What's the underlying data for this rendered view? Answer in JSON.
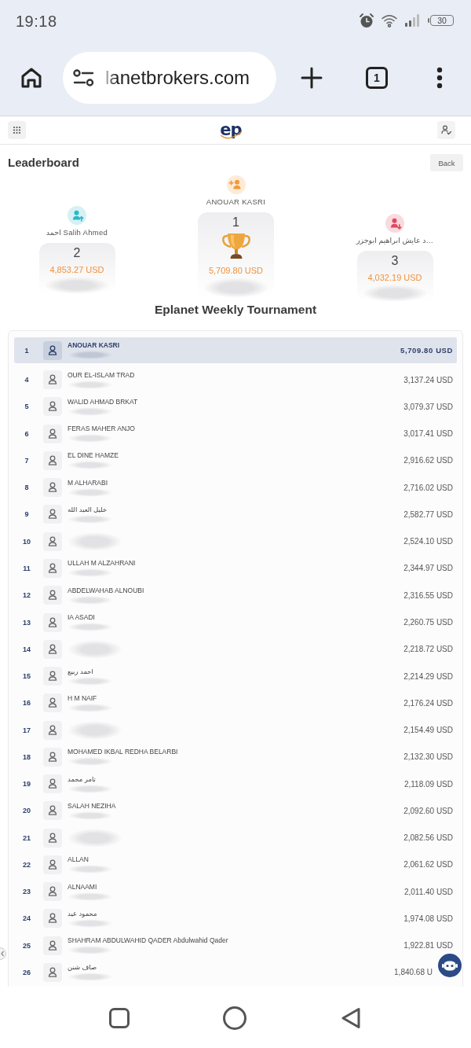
{
  "status_bar": {
    "time": "19:18",
    "battery": "30"
  },
  "browser": {
    "url": "lanetbrokers.com",
    "tab_count": "1"
  },
  "app_header": {
    "logo": "ep"
  },
  "page": {
    "title": "Leaderboard",
    "back_button": "Back"
  },
  "podium": [
    {
      "kind": "second",
      "name": "احمد Salih Ahmed",
      "rank": "2",
      "amount": "4,853.27 USD",
      "color": "#2bb8c8"
    },
    {
      "kind": "winner",
      "name": "ANOUAR KASRI",
      "rank": "1",
      "amount": "5,709.80 USD",
      "color": "#f39a3d"
    },
    {
      "kind": "third",
      "name": "د عايش ابراهيم ابوجزر…",
      "rank": "3",
      "amount": "4,032.19 USD",
      "color": "#e2475f"
    }
  ],
  "tournament": {
    "title": "Eplanet Weekly Tournament"
  },
  "leaderboard": {
    "rows": [
      {
        "rank": "1",
        "name": "ANOUAR KASRI",
        "amount": "5,709.80 USD",
        "selected": true
      },
      {
        "rank": "4",
        "name": "OUR EL-ISLAM TRAD",
        "amount": "3,137.24 USD",
        "selected": false
      },
      {
        "rank": "5",
        "name": "WALID AHMAD BRKAT",
        "amount": "3,079.37 USD",
        "selected": false
      },
      {
        "rank": "6",
        "name": "FERAS MAHER ANJO",
        "amount": "3,017.41 USD",
        "selected": false
      },
      {
        "rank": "7",
        "name": "EL DINE HAMZE",
        "amount": "2,916.62 USD",
        "selected": false
      },
      {
        "rank": "8",
        "name": "M ALHARABI",
        "amount": "2,716.02 USD",
        "selected": false
      },
      {
        "rank": "9",
        "name": "خليل العبد الله",
        "amount": "2,582.77 USD",
        "selected": false
      },
      {
        "rank": "10",
        "amount": "2,524.10 USD",
        "selected": false
      },
      {
        "rank": "11",
        "name": "ULLAH M ALZAHRANI",
        "amount": "2,344.97 USD",
        "selected": false
      },
      {
        "rank": "12",
        "name": "ABDELWAHAB ALNOUBI",
        "amount": "2,316.55 USD",
        "selected": false
      },
      {
        "rank": "13",
        "name": "IA ASADI",
        "amount": "2,260.75 USD",
        "selected": false
      },
      {
        "rank": "14",
        "amount": "2,218.72 USD",
        "selected": false
      },
      {
        "rank": "15",
        "name": "احمد ربيع",
        "amount": "2,214.29 USD",
        "selected": false
      },
      {
        "rank": "16",
        "name": "H M NAIF",
        "amount": "2,176.24 USD",
        "selected": false
      },
      {
        "rank": "17",
        "amount": "2,154.49 USD",
        "selected": false
      },
      {
        "rank": "18",
        "name": "MOHAMED IKBAL REDHA BELARBI",
        "amount": "2,132.30 USD",
        "selected": false
      },
      {
        "rank": "19",
        "name": "تامر محمد",
        "amount": "2,118.09 USD",
        "selected": false
      },
      {
        "rank": "20",
        "name": "SALAH NEZIHA",
        "amount": "2,092.60 USD",
        "selected": false
      },
      {
        "rank": "21",
        "amount": "2,082.56 USD",
        "selected": false
      },
      {
        "rank": "22",
        "name": "ALLAN",
        "amount": "2,061.62 USD",
        "selected": false
      },
      {
        "rank": "23",
        "name": "ALNAAMI",
        "amount": "2,011.40 USD",
        "selected": false
      },
      {
        "rank": "24",
        "name": "محمود عيد",
        "amount": "1,974.08 USD",
        "selected": false
      },
      {
        "rank": "25",
        "name": "SHAHRAM ABDULWAHID QADER Abdulwahid Qader",
        "amount": "1,922.81 USD",
        "selected": false
      },
      {
        "rank": "26",
        "name": "صاف شنن",
        "amount": "1,840.68 U",
        "selected": false
      }
    ]
  }
}
